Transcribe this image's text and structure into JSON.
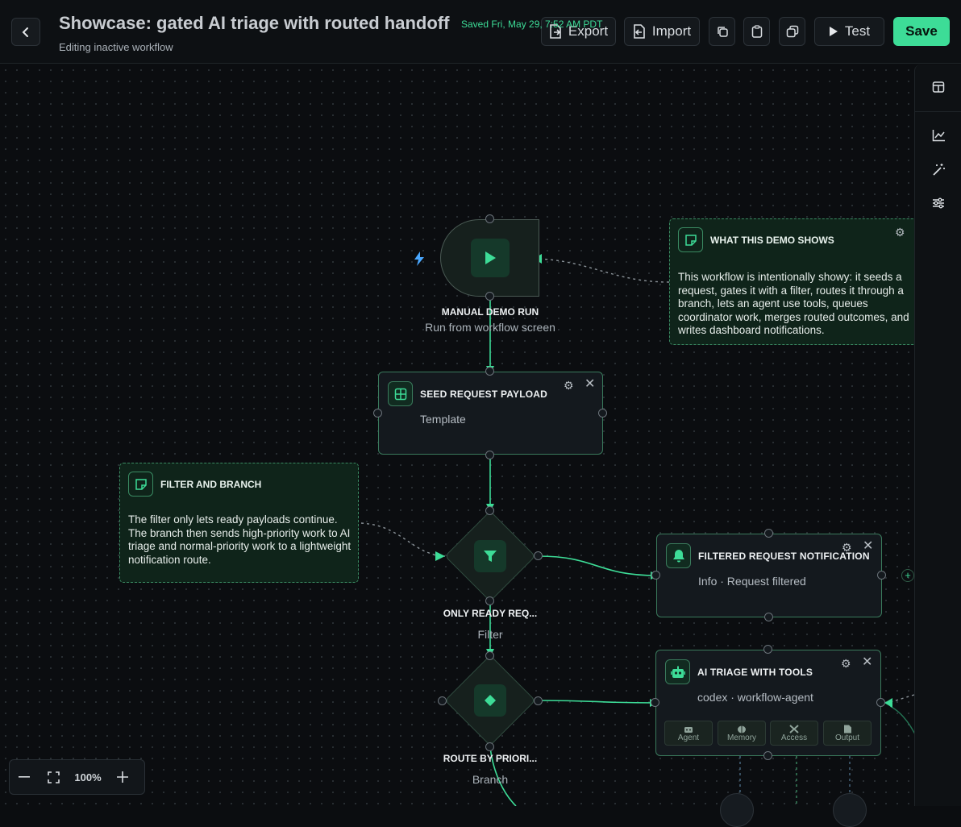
{
  "header": {
    "back_icon": "chevron-left-icon",
    "title": "Showcase: gated AI triage with routed handoff",
    "subtitle": "Editing inactive workflow",
    "saved_status": "Saved Fri, May 29, 7:52 AM PDT",
    "export_label": "Export",
    "import_label": "Import",
    "test_label": "Test",
    "save_label": "Save"
  },
  "nodes": {
    "manual_run": {
      "title": "MANUAL DEMO RUN",
      "subtitle": "Run from workflow screen"
    },
    "seed": {
      "title": "SEED REQUEST PAYLOAD",
      "subtitle": "Template"
    },
    "filter": {
      "title": "ONLY READY REQ...",
      "subtitle": "Filter"
    },
    "branch": {
      "title": "ROUTE BY PRIORI...",
      "subtitle": "Branch"
    },
    "filtered_notification": {
      "title": "FILTERED REQUEST NOTIFICATION",
      "subtitle": "Info · Request filtered"
    },
    "ai_triage": {
      "title": "AI TRIAGE WITH TOOLS",
      "subtitle": "codex · workflow-agent",
      "tabs": [
        "Agent",
        "Memory",
        "Access",
        "Output"
      ]
    }
  },
  "notes": {
    "demo": {
      "title": "WHAT THIS DEMO SHOWS",
      "body": "This workflow is intentionally showy: it seeds a request, gates it with a filter, routes it through a branch, lets an agent use tools, queues coordinator work, merges routed outcomes, and writes dashboard notifications."
    },
    "filter_branch": {
      "title": "FILTER AND BRANCH",
      "body": "The filter only lets ready payloads continue. The branch then sends high-priority work to AI triage and normal-priority work to a lightweight notification route."
    }
  },
  "zoom": {
    "level": "100%"
  },
  "colors": {
    "accent": "#3ddc97",
    "background": "#0b0d10",
    "card": "#14191e",
    "border": "#3a7a5c"
  }
}
